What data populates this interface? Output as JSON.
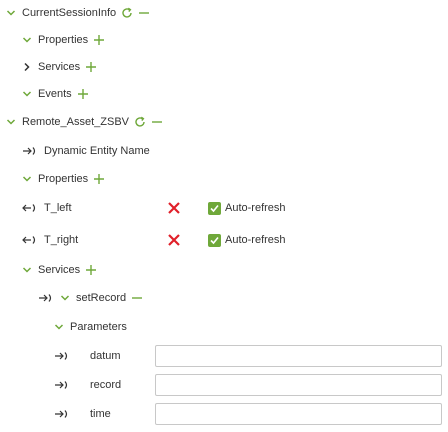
{
  "tree": {
    "current_session_info": "CurrentSessionInfo",
    "properties_1": "Properties",
    "services_1": "Services",
    "events_1": "Events",
    "remote_asset": "Remote_Asset_ZSBV",
    "dynamic_entity_name": "Dynamic Entity Name",
    "properties_2": "Properties",
    "prop_tleft": "T_left",
    "prop_tright": "T_right",
    "auto_refresh": "Auto-refresh",
    "services_2": "Services",
    "set_record": "setRecord",
    "parameters": "Parameters",
    "params": [
      {
        "name": "datum",
        "value": ""
      },
      {
        "name": "record",
        "value": ""
      },
      {
        "name": "time",
        "value": ""
      }
    ]
  },
  "colors": {
    "accent_green": "#6fa83a",
    "remove_red": "#e0202a",
    "text": "#333333"
  },
  "icons": {
    "expand": "chevron-down-icon",
    "collapse": "chevron-right-icon",
    "refresh": "refresh-icon",
    "remove": "minus-icon",
    "add": "plus-icon",
    "input_arrow": "input-arrow-icon",
    "output_arrow": "output-arrow-icon",
    "delete": "close-icon",
    "checkbox": "checkbox-checked-icon"
  }
}
